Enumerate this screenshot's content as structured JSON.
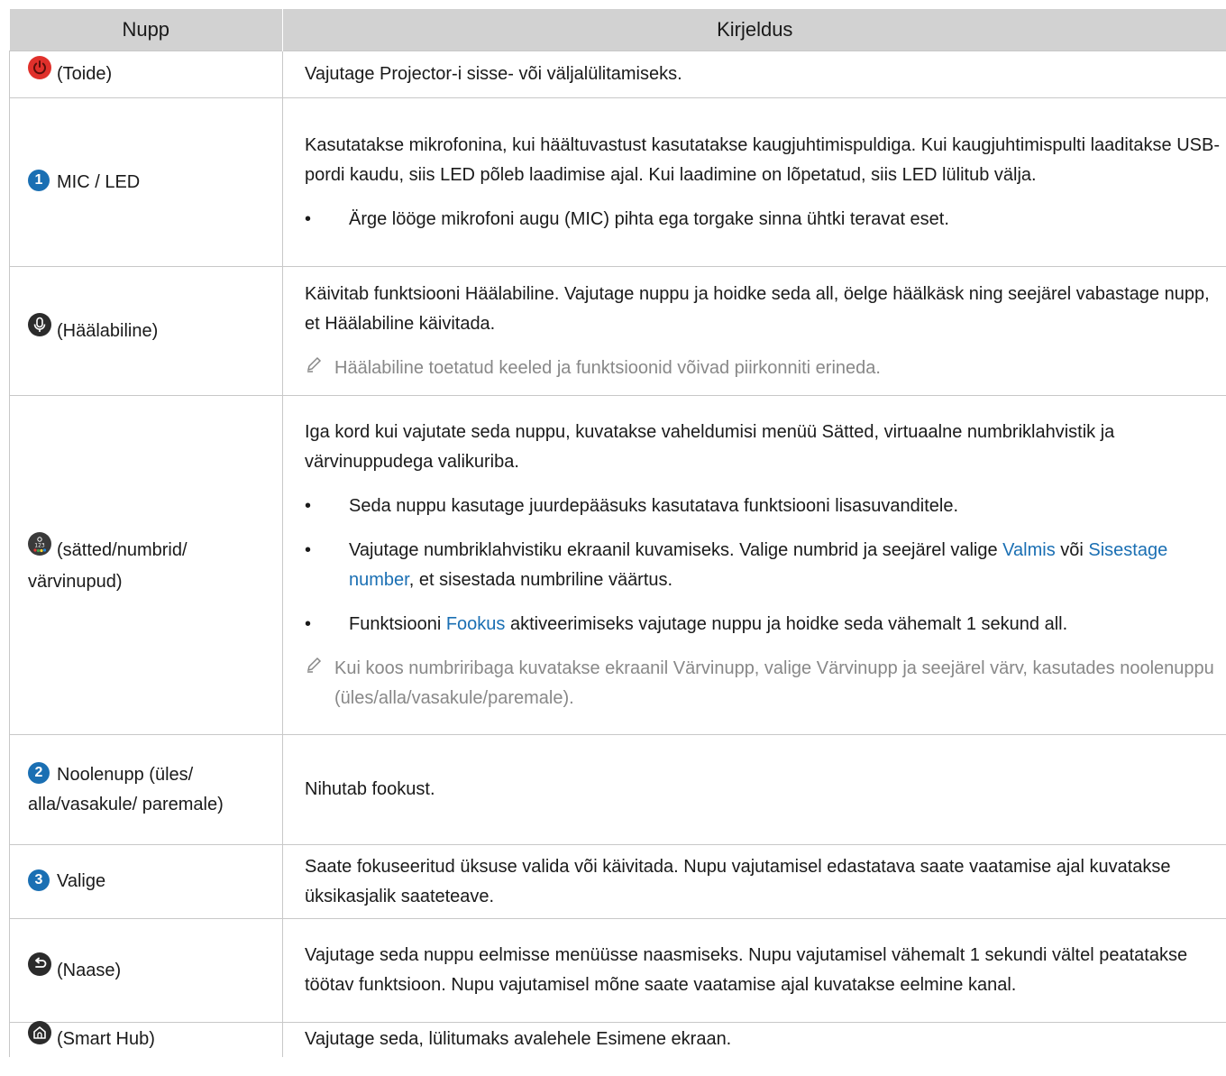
{
  "header": {
    "col1": "Nupp",
    "col2": "Kirjeldus"
  },
  "rows": {
    "power": {
      "label": "(Toide)",
      "desc": "Vajutage Projector-i sisse- või väljalülitamiseks."
    },
    "mic": {
      "num": "1",
      "label": "MIC / LED",
      "desc": "Kasutatakse mikrofonina, kui hääl­tuvastust kasutatakse kaugjuhtimispuldiga. Kui kaugjuhtimispulti laaditakse USB-pordi kaudu, siis LED põleb laadimise ajal. Kui laadimine on lõpetatud, siis LED lülitub välja.",
      "bullet": "Ärge lööge mikrofoni augu (MIC) pihta ega torgake sinna ühtki teravat eset."
    },
    "voice": {
      "label": "(Häälabiline)",
      "desc": "Käivitab funktsiooni Häälabiline. Vajutage nuppu ja hoidke seda all, öelge häälkäsk ning seejärel vabastage nupp, et Häälabiline käivitada.",
      "note": "Häälabiline toetatud keeled ja funktsioonid võivad piirkonniti erineda."
    },
    "settings": {
      "label": "(sätted/numbrid/ värvinupud)",
      "desc": "Iga kord kui vajutate seda nuppu, kuvatakse vaheldumisi menüü Sätted, virtuaalne numbriklahvistik ja värvinuppudega valikuriba.",
      "bullet1": "Seda nuppu kasutage juurdepääsuks kasutatava funktsiooni lisasuvanditele.",
      "bullet2_a": "Vajutage numbriklahvistiku ekraanil kuvamiseks. Valige numbrid ja seejärel valige ",
      "bullet2_link1": "Valmis",
      "bullet2_b": " või ",
      "bullet2_link2": "Sisestage number",
      "bullet2_c": ", et sisestada numbriline väärtus.",
      "bullet3_a": "Funktsiooni ",
      "bullet3_link": "Fookus",
      "bullet3_b": " aktiveerimiseks vajutage nuppu ja hoidke seda vähemalt 1 sekund all.",
      "note": "Kui koos numbriribaga kuvatakse ekraanil Värvinupp, valige Värvinupp ja seejärel värv, kasutades noolenuppu (üles/alla/vasakule/paremale)."
    },
    "arrows": {
      "num": "2",
      "label": "Noolenupp (üles/ alla/vasakule/ paremale)",
      "desc": "Nihutab fookust."
    },
    "select": {
      "num": "3",
      "label": "Valige",
      "desc": "Saate fokuseeritud üksuse valida või käivitada. Nupu vajutamisel edastatava saate vaatamise ajal kuvatakse üksikasjalik saateteave."
    },
    "back": {
      "label": "(Naase)",
      "desc": "Vajutage seda nuppu eelmisse menüüsse naasmiseks. Nupu vajutamisel vähemalt 1 sekundi vältel peatatakse töötav funktsioon. Nupu vajutamisel mõne saate vaatamise ajal kuvatakse eelmine kanal."
    },
    "home": {
      "label": "(Smart Hub)",
      "desc": "Vajutage seda, lülitumaks avalehele Esimene ekraan."
    }
  },
  "icons": {
    "power": "power-icon",
    "voice": "microphone-icon",
    "settings": "settings-numbers-colors-icon",
    "back": "back-arrow-icon",
    "home": "home-icon",
    "note": "pencil-note-icon"
  },
  "colors": {
    "power": "#e0302b",
    "accent": "#1a6fb3",
    "header_bg": "#d2d2d2",
    "note_text": "#888888"
  }
}
